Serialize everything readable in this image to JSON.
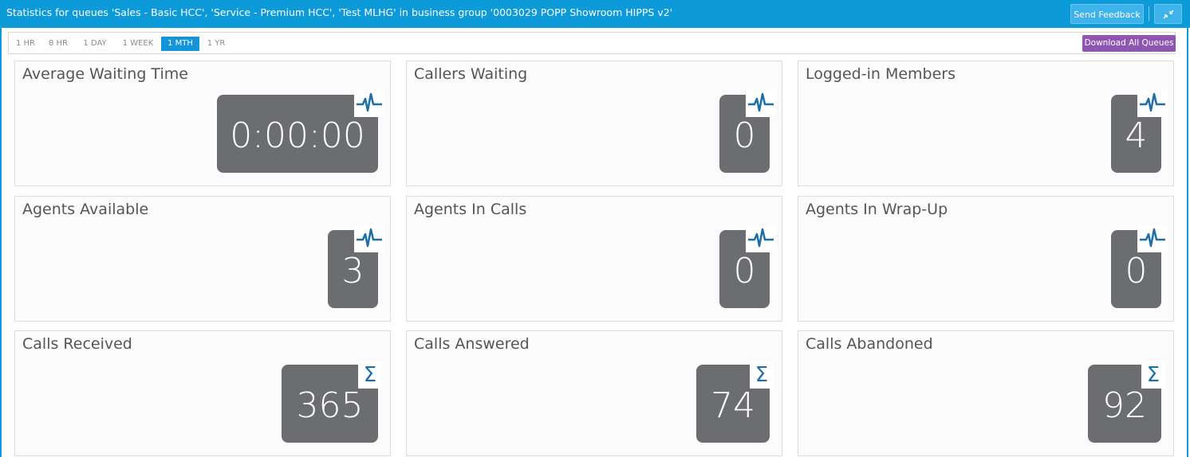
{
  "header": {
    "title": "Statistics for queues 'Sales - Basic HCC', 'Service - Premium HCC', 'Test MLHG' in business group '0003029 POPP Showroom HIPPS v2'",
    "send_feedback_label": "Send Feedback",
    "collapse_icon": "compress-icon"
  },
  "toolbar": {
    "ranges": [
      "1 HR",
      "8 HR",
      "1 DAY",
      "1 WEEK",
      "1 MTH",
      "1 YR"
    ],
    "active_range": "1 MTH",
    "download_label": "Download All Queues"
  },
  "colors": {
    "header_bg": "#0d9ad8",
    "active_range_bg": "#1595d9",
    "download_bg": "#8e55b3",
    "value_box_bg": "#6b6d70",
    "icon_color": "#1b6ea7"
  },
  "tiles": [
    {
      "label": "Average Waiting Time",
      "value": "0:00:00",
      "icon": "pulse-icon"
    },
    {
      "label": "Callers Waiting",
      "value": "0",
      "icon": "pulse-icon"
    },
    {
      "label": "Logged-in Members",
      "value": "4",
      "icon": "pulse-icon"
    },
    {
      "label": "Agents Available",
      "value": "3",
      "icon": "pulse-icon"
    },
    {
      "label": "Agents In Calls",
      "value": "0",
      "icon": "pulse-icon"
    },
    {
      "label": "Agents In Wrap-Up",
      "value": "0",
      "icon": "pulse-icon"
    },
    {
      "label": "Calls Received",
      "value": "365",
      "icon": "sigma-icon"
    },
    {
      "label": "Calls Answered",
      "value": "74",
      "icon": "sigma-icon"
    },
    {
      "label": "Calls Abandoned",
      "value": "92",
      "icon": "sigma-icon"
    }
  ],
  "sigma_glyph": "Σ"
}
